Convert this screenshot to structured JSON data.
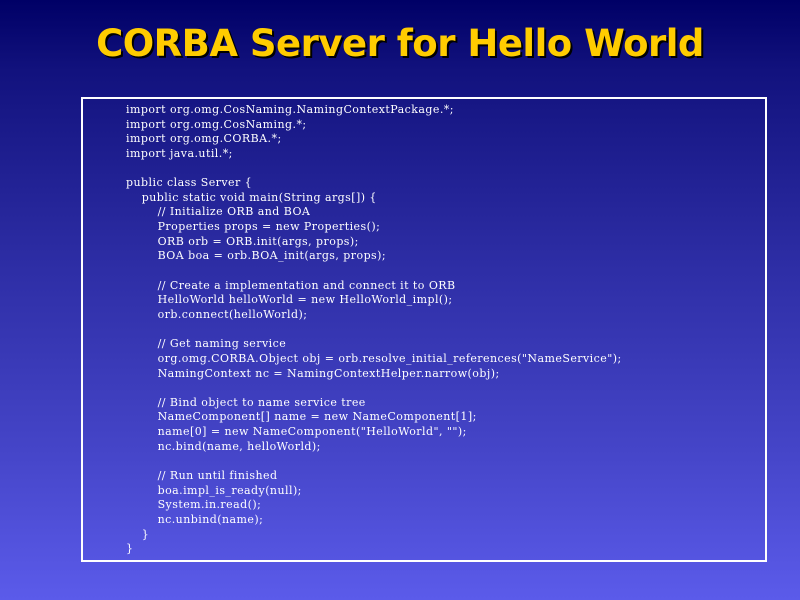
{
  "slide": {
    "title": "CORBA Server for Hello World"
  },
  "colors": {
    "title": "#ffcc00",
    "code_text": "#ffffff",
    "box_border": "#ffffff",
    "background_top": "#000066",
    "background_bottom": "#5b5bea"
  },
  "code": {
    "lines": [
      "import org.omg.CosNaming.NamingContextPackage.*;",
      "import org.omg.CosNaming.*;",
      "import org.omg.CORBA.*;",
      "import java.util.*;",
      "",
      "public class Server {",
      "    public static void main(String args[]) {",
      "        // Initialize ORB and BOA",
      "        Properties props = new Properties();",
      "        ORB orb = ORB.init(args, props);",
      "        BOA boa = orb.BOA_init(args, props);",
      "",
      "        // Create a implementation and connect it to ORB",
      "        HelloWorld helloWorld = new HelloWorld_impl();",
      "        orb.connect(helloWorld);",
      "",
      "        // Get naming service",
      "        org.omg.CORBA.Object obj = orb.resolve_initial_references(\"NameService\");",
      "        NamingContext nc = NamingContextHelper.narrow(obj);",
      "",
      "        // Bind object to name service tree",
      "        NameComponent[] name = new NameComponent[1];",
      "        name[0] = new NameComponent(\"HelloWorld\", \"\");",
      "        nc.bind(name, helloWorld);",
      "",
      "        // Run until finished",
      "        boa.impl_is_ready(null);",
      "        System.in.read();",
      "        nc.unbind(name);",
      "    }",
      "}"
    ]
  }
}
